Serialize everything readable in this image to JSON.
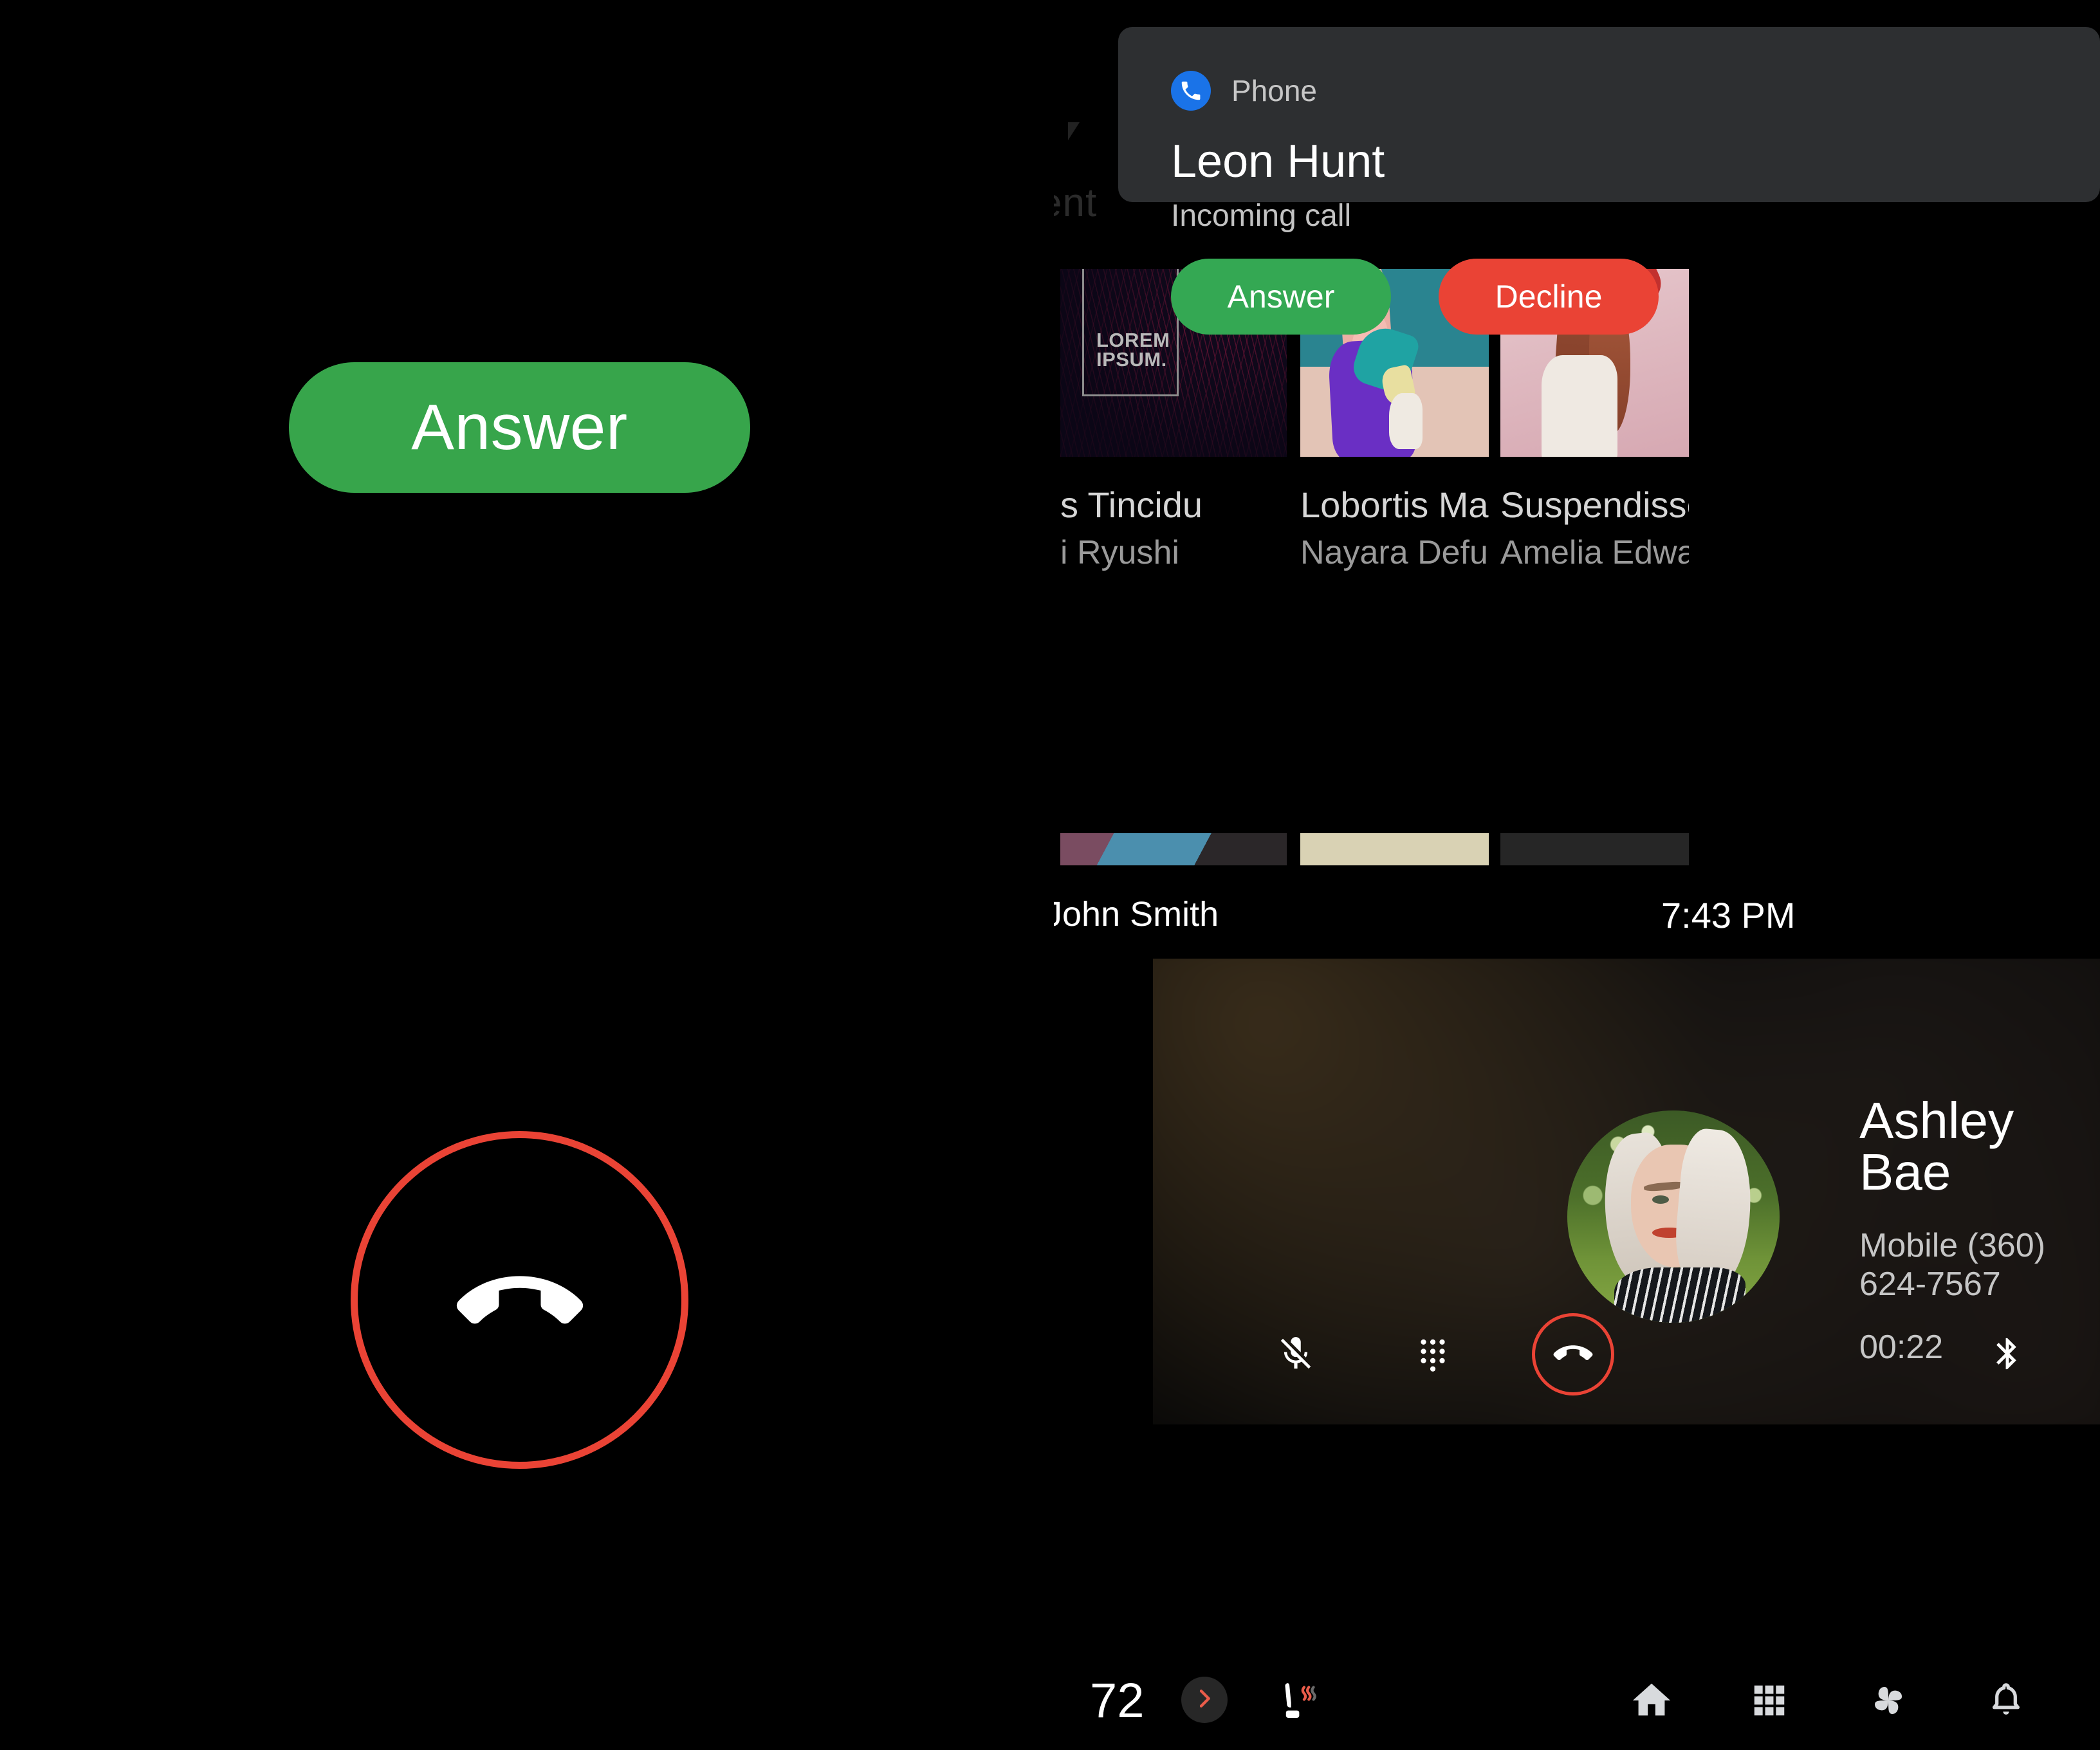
{
  "left_panel": {
    "answer_button_label": "Answer",
    "end_call_icon": "call-end-icon",
    "background_color": "#000000",
    "answer_button_color": "#37A54B",
    "end_call_ring_color": "#EA4335"
  },
  "notification": {
    "app_icon": "phone-icon",
    "app_name": "Phone",
    "title": "Leon Hunt",
    "body": "Incoming call",
    "answer_label": "Answer",
    "decline_label": "Decline",
    "answer_color": "#34A853",
    "decline_color": "#EA4335",
    "panel_color": "#2D2F31",
    "app_icon_color": "#1A73E8"
  },
  "background_app": {
    "cut_off_label": "ent",
    "media_cards": [
      {
        "title": "s Tincidu",
        "artist": "i Ryushi",
        "art": "lorem-ipsum-topographic"
      },
      {
        "title": "Lobortis Magn",
        "artist": "Nayara Defuente",
        "art": "fashion-purple-jacket"
      },
      {
        "title": "Suspendisse",
        "artist": "Amelia Edwards",
        "art": "portrait-pink"
      }
    ],
    "lorem_box_line1": "LOREM",
    "lorem_box_line2": "IPSUM."
  },
  "status_bar": {
    "user_name": "John Smith",
    "time": "7:43 PM"
  },
  "call_card": {
    "callee_name": "Ashley Bae",
    "phone_label": "Mobile (360) 624-7567",
    "duration": "00:22",
    "avatar": "contact-photo",
    "controls": [
      {
        "name": "mute-button",
        "icon": "mic-off-icon"
      },
      {
        "name": "dialpad-button",
        "icon": "dialpad-icon"
      },
      {
        "name": "end-call-button",
        "icon": "call-end-icon",
        "color": "#EA4335"
      },
      {
        "name": "bluetooth-button",
        "icon": "bluetooth-icon"
      }
    ]
  },
  "bottom_nav": {
    "temperature": "72",
    "temperature_chevron": "chevron-right-icon",
    "seat_heat_icon": "heated-seat-icon",
    "items": [
      {
        "name": "home",
        "icon": "home-icon"
      },
      {
        "name": "apps",
        "icon": "apps-grid-icon"
      },
      {
        "name": "climate",
        "icon": "fan-icon"
      },
      {
        "name": "notifications",
        "icon": "bell-icon"
      }
    ],
    "chevron_color": "#EA5C4A"
  }
}
